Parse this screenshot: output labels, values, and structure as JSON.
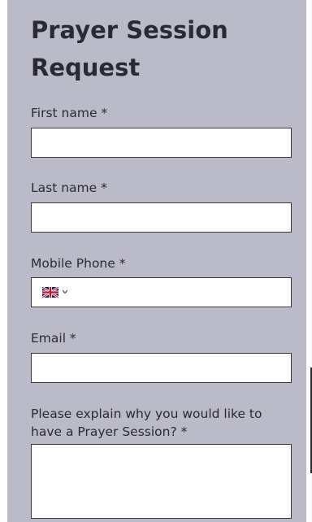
{
  "form": {
    "title": "Prayer Session Request",
    "colors": {
      "panel_background": "#bbbac9",
      "text": "#2a2a35",
      "field_border": "#3a3a44"
    },
    "fields": {
      "first_name": {
        "label": "First name *",
        "value": ""
      },
      "last_name": {
        "label": "Last name *",
        "value": ""
      },
      "mobile_phone": {
        "label": "Mobile Phone *",
        "country": "united-kingdom-flag-icon",
        "value": ""
      },
      "email": {
        "label": "Email *",
        "value": ""
      },
      "reason": {
        "label": "Please explain why you would like to have a Prayer Session? *",
        "value": ""
      }
    }
  }
}
